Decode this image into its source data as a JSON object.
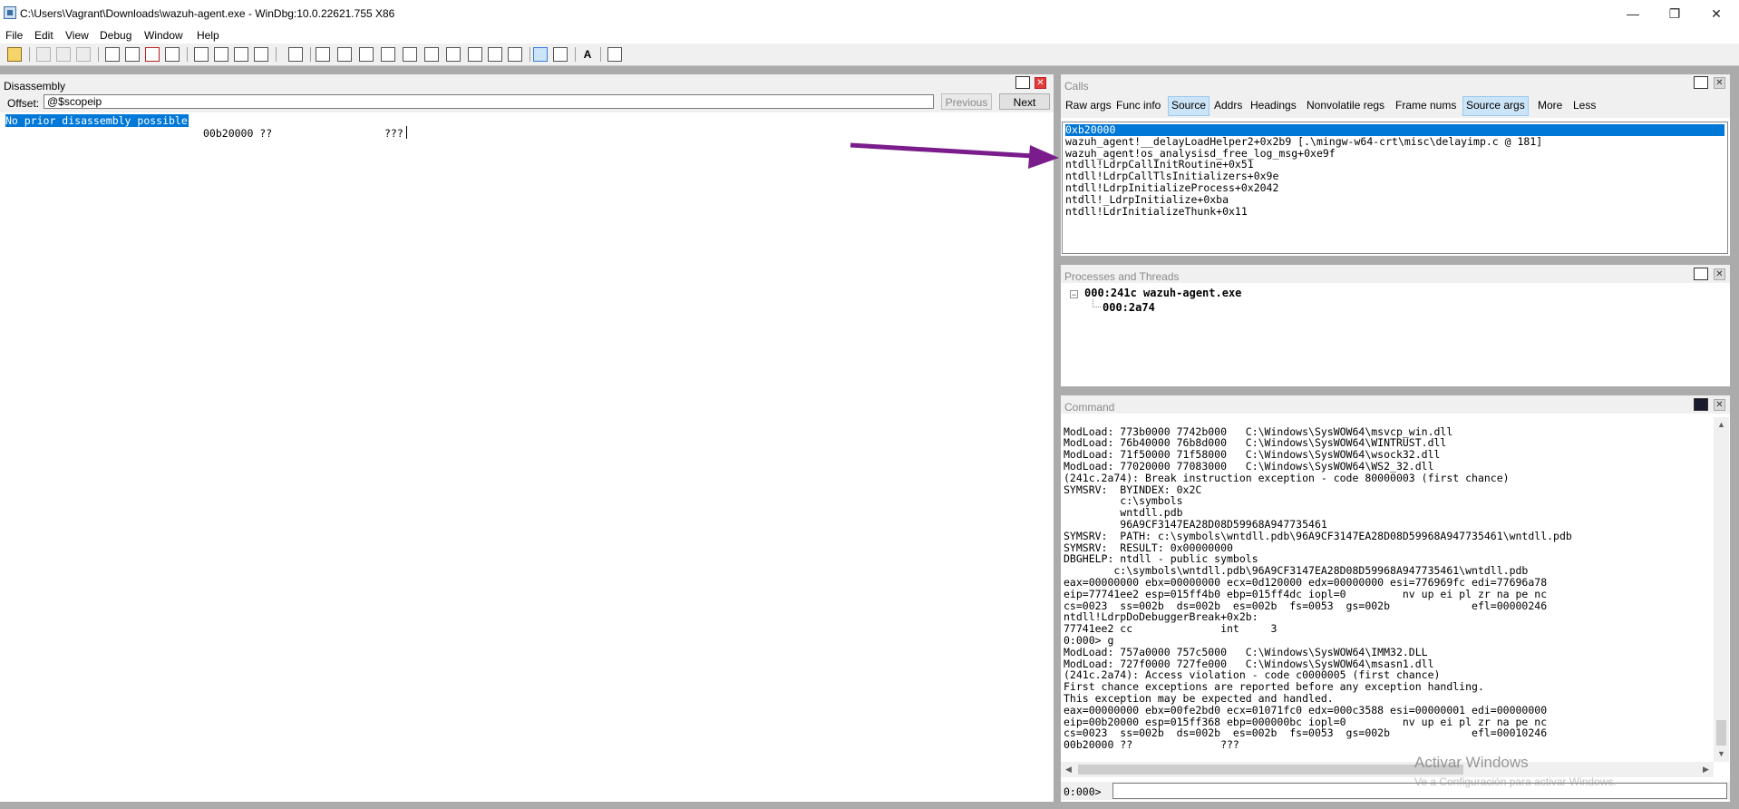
{
  "window": {
    "title": "C:\\Users\\Vagrant\\Downloads\\wazuh-agent.exe - WinDbg:10.0.22621.755 X86",
    "minimize": "—",
    "maximize": "❐",
    "close": "✕"
  },
  "menu": [
    "File",
    "Edit",
    "View",
    "Debug",
    "Window",
    "Help"
  ],
  "disassembly": {
    "title": "Disassembly",
    "offset_label": "Offset:",
    "offset_value": "@$scopeip",
    "previous_label": "Previous",
    "next_label": "Next",
    "lines": [
      "No prior disassembly possible",
      "00b20000 ??",
      "???"
    ]
  },
  "calls": {
    "title": "Calls",
    "tabs": [
      {
        "label": "Raw args",
        "active": false
      },
      {
        "label": "Func info",
        "active": false
      },
      {
        "label": "Source",
        "active": true
      },
      {
        "label": "Addrs",
        "active": false
      },
      {
        "label": "Headings",
        "active": false
      },
      {
        "label": "Nonvolatile regs",
        "active": false
      },
      {
        "label": "Frame nums",
        "active": false
      },
      {
        "label": "Source args",
        "active": true
      },
      {
        "label": "More",
        "active": false
      },
      {
        "label": "Less",
        "active": false
      }
    ],
    "frames": [
      "0xb20000",
      "wazuh_agent!__delayLoadHelper2+0x2b9 [.\\mingw-w64-crt\\misc\\delayimp.c @ 181]",
      "wazuh_agent!os_analysisd_free_log_msg+0xe9f",
      "ntdll!LdrpCallInitRoutine+0x51",
      "ntdll!LdrpCallTlsInitializers+0x9e",
      "ntdll!LdrpInitializeProcess+0x2042",
      "ntdll!_LdrpInitialize+0xba",
      "ntdll!LdrInitializeThunk+0x11"
    ],
    "selected_index": 0
  },
  "processes": {
    "title": "Processes and Threads",
    "process": "000:241c wazuh-agent.exe",
    "thread": "000:2a74"
  },
  "command": {
    "title": "Command",
    "output": [
      "ModLoad: 773b0000 7742b000   C:\\Windows\\SysWOW64\\msvcp_win.dll",
      "ModLoad: 76b40000 76b8d000   C:\\Windows\\SysWOW64\\WINTRUST.dll",
      "ModLoad: 71f50000 71f58000   C:\\Windows\\SysWOW64\\wsock32.dll",
      "ModLoad: 77020000 77083000   C:\\Windows\\SysWOW64\\WS2_32.dll",
      "(241c.2a74): Break instruction exception - code 80000003 (first chance)",
      "SYMSRV:  BYINDEX: 0x2C",
      "         c:\\symbols",
      "         wntdll.pdb",
      "         96A9CF3147EA28D08D59968A947735461",
      "SYMSRV:  PATH: c:\\symbols\\wntdll.pdb\\96A9CF3147EA28D08D59968A947735461\\wntdll.pdb",
      "SYMSRV:  RESULT: 0x00000000",
      "DBGHELP: ntdll - public symbols",
      "        c:\\symbols\\wntdll.pdb\\96A9CF3147EA28D08D59968A947735461\\wntdll.pdb",
      "eax=00000000 ebx=00000000 ecx=0d120000 edx=00000000 esi=776969fc edi=77696a78",
      "eip=77741ee2 esp=015ff4b0 ebp=015ff4dc iopl=0         nv up ei pl zr na pe nc",
      "cs=0023  ss=002b  ds=002b  es=002b  fs=0053  gs=002b             efl=00000246",
      "ntdll!LdrpDoDebuggerBreak+0x2b:",
      "77741ee2 cc              int     3",
      "0:000> g",
      "ModLoad: 757a0000 757c5000   C:\\Windows\\SysWOW64\\IMM32.DLL",
      "ModLoad: 727f0000 727fe000   C:\\Windows\\SysWOW64\\msasn1.dll",
      "(241c.2a74): Access violation - code c0000005 (first chance)",
      "First chance exceptions are reported before any exception handling.",
      "This exception may be expected and handled.",
      "eax=00000000 ebx=00fe2bd0 ecx=01071fc0 edx=000c3588 esi=00000001 edi=00000000",
      "eip=00b20000 esp=015ff368 ebp=000000bc iopl=0         nv up ei pl zr na pe nc",
      "cs=0023  ss=002b  ds=002b  es=002b  fs=0053  gs=002b             efl=00010246",
      "00b20000 ??              ???"
    ],
    "prompt": "0:000>",
    "input_value": ""
  },
  "watermark": {
    "line1": "Activar Windows",
    "line2": "Ve a Configuración para activar Windows."
  },
  "annotation_arrow_color": "#7b1c8c",
  "selection_color": "#0078d7"
}
